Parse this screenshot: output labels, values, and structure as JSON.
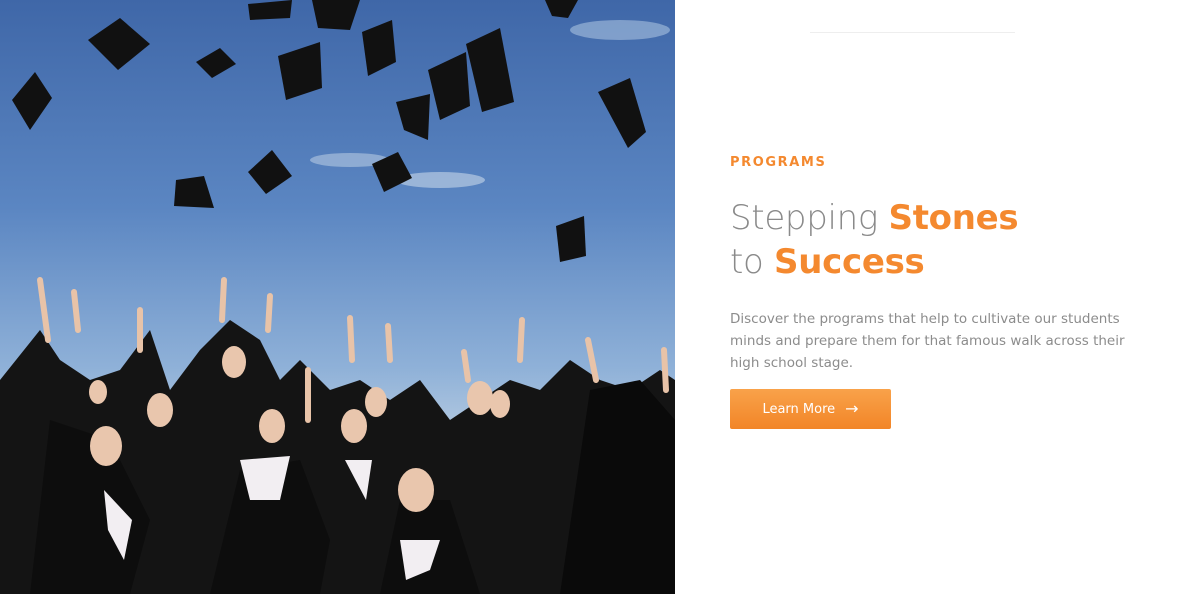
{
  "section": {
    "eyebrow": "PROGRAMS",
    "headline": {
      "line1_light": "Stepping ",
      "line1_accent": "Stones",
      "line2_light": "to ",
      "line2_accent": "Success"
    },
    "description": "Discover the programs that help to cultivate our students minds and prepare them for that famous walk across their high school stage.",
    "cta_label": "Learn More",
    "cta_icon": "arrow-right-icon"
  },
  "image": {
    "subject": "graduation-photo"
  },
  "colors": {
    "accent": "#f4892f",
    "text": "#8c8c8c"
  }
}
